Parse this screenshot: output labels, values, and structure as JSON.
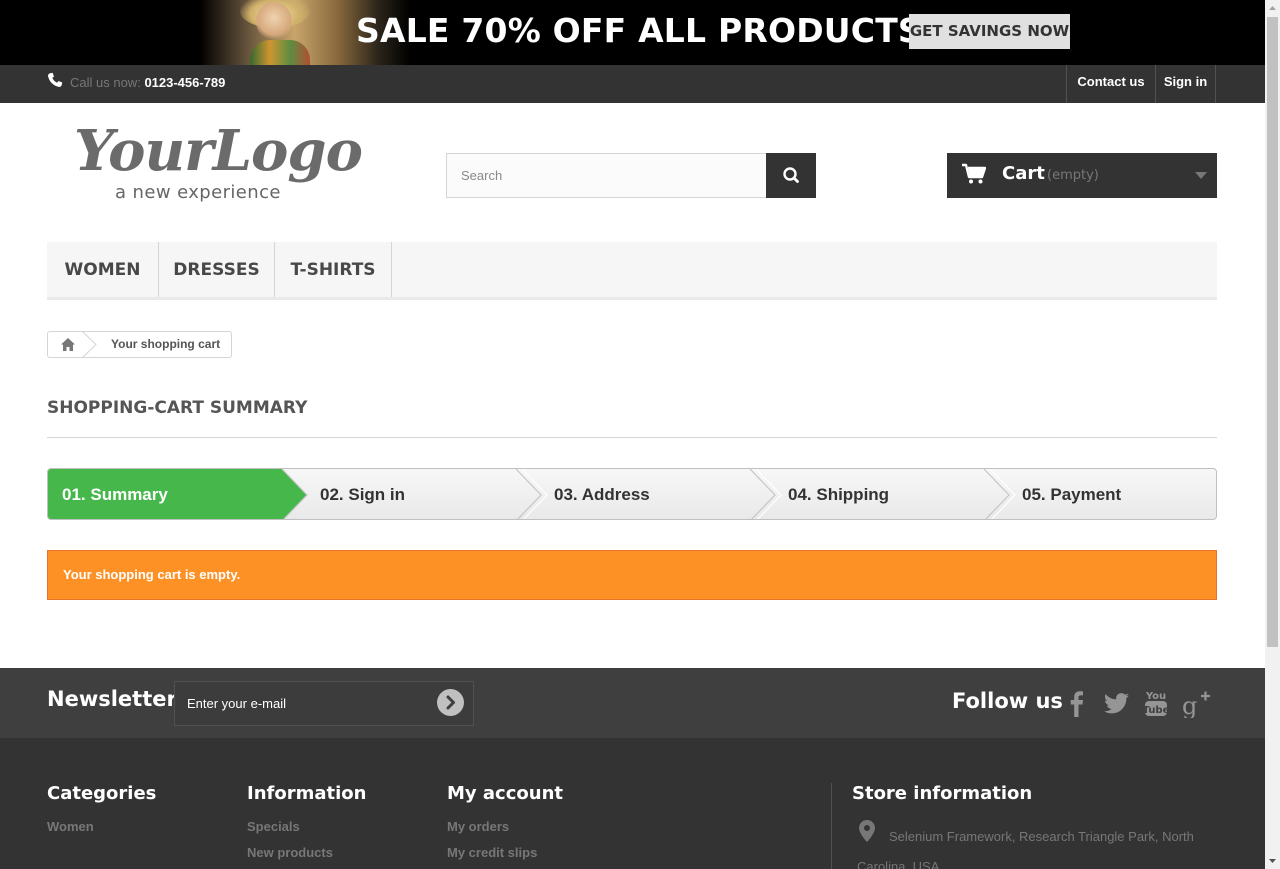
{
  "banner": {
    "headline": "SALE 70% OFF ALL PRODUCTS",
    "button_label": "GET SAVINGS NOW"
  },
  "topbar": {
    "call_label": "Call us now:",
    "phone": "0123-456-789",
    "contact_label": "Contact us",
    "signin_label": "Sign in"
  },
  "header": {
    "logo_main": "YourLogo",
    "logo_tagline": "a new experience",
    "search_placeholder": "Search",
    "cart_label": "Cart",
    "cart_status": "(empty)"
  },
  "menu": {
    "items": [
      "WOMEN",
      "DRESSES",
      "T-SHIRTS"
    ]
  },
  "breadcrumb": {
    "current": "Your shopping cart"
  },
  "page": {
    "heading": "SHOPPING-CART SUMMARY",
    "steps": [
      "01. Summary",
      "02. Sign in",
      "03. Address",
      "04. Shipping",
      "05. Payment"
    ],
    "active_step": 0,
    "alert": "Your shopping cart is empty."
  },
  "newsletter": {
    "title": "Newsletter",
    "placeholder": "Enter your e-mail",
    "follow_title": "Follow us",
    "social_icons": [
      "facebook-icon",
      "twitter-icon",
      "youtube-icon",
      "google-plus-icon"
    ]
  },
  "footer": {
    "categories": {
      "title": "Categories",
      "links": [
        "Women"
      ]
    },
    "information": {
      "title": "Information",
      "links": [
        "Specials",
        "New products"
      ]
    },
    "my_account": {
      "title": "My account",
      "links": [
        "My orders",
        "My credit slips"
      ]
    },
    "store": {
      "title": "Store information",
      "address": "Selenium Framework, Research Triangle Park, North Carolina, USA"
    }
  },
  "colors": {
    "active_step": "#45b74b",
    "alert": "#fe9126",
    "dark": "#333333"
  }
}
